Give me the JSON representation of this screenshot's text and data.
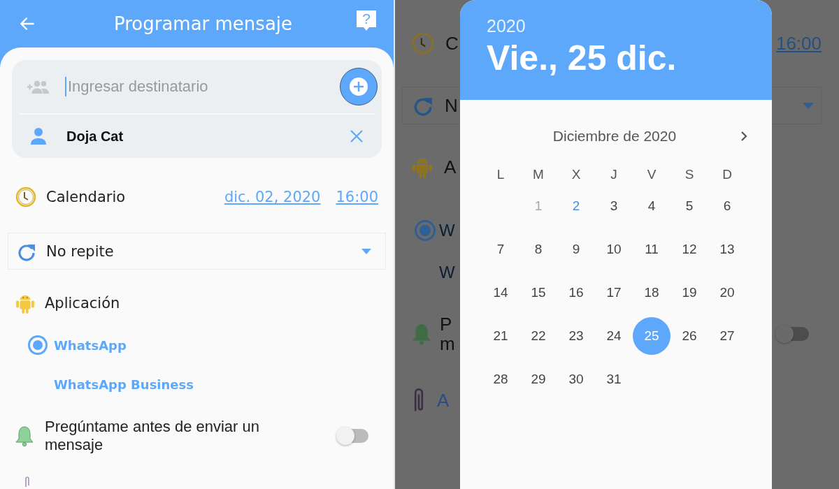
{
  "left": {
    "header": {
      "title": "Programar mensaje",
      "help_glyph": "?"
    },
    "recipient": {
      "placeholder": "Ingresar destinatario",
      "contacts": [
        {
          "name": "Doja Cat"
        }
      ]
    },
    "schedule": {
      "label": "Calendario",
      "date": "dic. 02, 2020",
      "time": "16:00"
    },
    "repeat": {
      "value": "No repite"
    },
    "app": {
      "label": "Aplicación",
      "options": [
        {
          "label": "WhatsApp",
          "selected": true
        },
        {
          "label": "WhatsApp Business",
          "selected": false
        }
      ]
    },
    "confirm": {
      "label": "Pregúntame antes de enviar un mensaje",
      "on": false
    }
  },
  "right": {
    "background": {
      "schedule_label": "C",
      "time": "16:00",
      "repeat_value": "N",
      "app_label": "A",
      "options": [
        {
          "label": "W",
          "selected": true
        },
        {
          "label": "W",
          "selected": false
        }
      ],
      "confirm_lines": [
        "P",
        "m"
      ],
      "confirm_on": false,
      "attach_label": "A"
    },
    "date_picker": {
      "year": "2020",
      "date": "Vie., 25 dic.",
      "month": "Diciembre de 2020",
      "weekdays": [
        "L",
        "M",
        "X",
        "J",
        "V",
        "S",
        "D"
      ],
      "weeks": [
        [
          {
            "day": "1",
            "disabled": true,
            "today": false,
            "selected": false
          },
          {
            "day": "2",
            "disabled": false,
            "today": true,
            "selected": false
          },
          {
            "day": "3",
            "disabled": false,
            "today": false,
            "selected": false
          },
          {
            "day": "4",
            "disabled": false,
            "today": false,
            "selected": false
          },
          {
            "day": "5",
            "disabled": false,
            "today": false,
            "selected": false
          },
          {
            "day": "6",
            "disabled": false,
            "today": false,
            "selected": false
          }
        ],
        [
          {
            "day": "7",
            "disabled": false,
            "today": false,
            "selected": false
          },
          {
            "day": "8",
            "disabled": false,
            "today": false,
            "selected": false
          },
          {
            "day": "9",
            "disabled": false,
            "today": false,
            "selected": false
          },
          {
            "day": "10",
            "disabled": false,
            "today": false,
            "selected": false
          },
          {
            "day": "11",
            "disabled": false,
            "today": false,
            "selected": false
          },
          {
            "day": "12",
            "disabled": false,
            "today": false,
            "selected": false
          },
          {
            "day": "13",
            "disabled": false,
            "today": false,
            "selected": false
          }
        ],
        [
          {
            "day": "14",
            "disabled": false,
            "today": false,
            "selected": false
          },
          {
            "day": "15",
            "disabled": false,
            "today": false,
            "selected": false
          },
          {
            "day": "16",
            "disabled": false,
            "today": false,
            "selected": false
          },
          {
            "day": "17",
            "disabled": false,
            "today": false,
            "selected": false
          },
          {
            "day": "18",
            "disabled": false,
            "today": false,
            "selected": false
          },
          {
            "day": "19",
            "disabled": false,
            "today": false,
            "selected": false
          },
          {
            "day": "20",
            "disabled": false,
            "today": false,
            "selected": false
          }
        ],
        [
          {
            "day": "21",
            "disabled": false,
            "today": false,
            "selected": false
          },
          {
            "day": "22",
            "disabled": false,
            "today": false,
            "selected": false
          },
          {
            "day": "23",
            "disabled": false,
            "today": false,
            "selected": false
          },
          {
            "day": "24",
            "disabled": false,
            "today": false,
            "selected": false
          },
          {
            "day": "25",
            "disabled": false,
            "today": false,
            "selected": true
          },
          {
            "day": "26",
            "disabled": false,
            "today": false,
            "selected": false
          },
          {
            "day": "27",
            "disabled": false,
            "today": false,
            "selected": false
          }
        ],
        [
          {
            "day": "28",
            "disabled": false,
            "today": false,
            "selected": false
          },
          {
            "day": "29",
            "disabled": false,
            "today": false,
            "selected": false
          },
          {
            "day": "30",
            "disabled": false,
            "today": false,
            "selected": false
          },
          {
            "day": "31",
            "disabled": false,
            "today": false,
            "selected": false
          }
        ]
      ]
    }
  }
}
